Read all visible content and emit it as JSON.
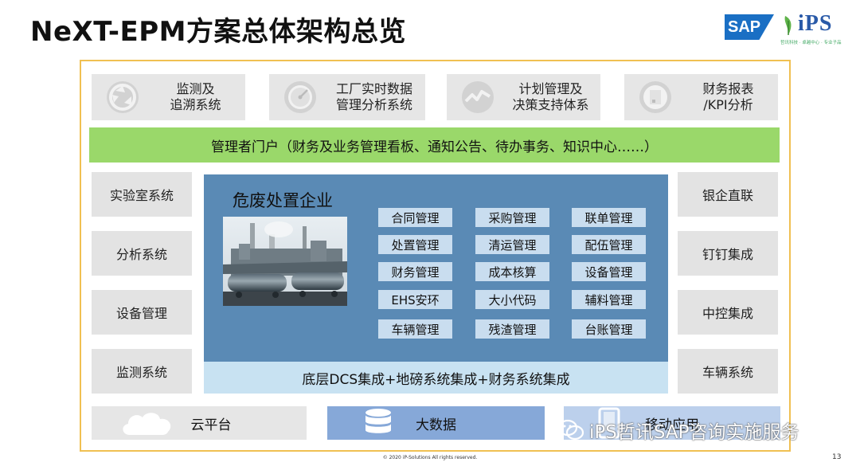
{
  "title": "NeXT-EPM方案总体架构总览",
  "logo": {
    "brand": "SAP",
    "partner": "iPS",
    "tagline": "哲讯科技 · 卓越中心 · 专业子品"
  },
  "top_systems": [
    {
      "label": "监测及\n追溯系统",
      "icon": "recycle-icon"
    },
    {
      "label": "工厂实时数据\n管理分析系统",
      "icon": "gauge-icon"
    },
    {
      "label": "计划管理及\n决策支持体系",
      "icon": "trend-icon"
    },
    {
      "label": "财务报表\n/KPI分析",
      "icon": "document-icon"
    }
  ],
  "portal": "管理者门户（财务及业务管理看板、通知公告、待办事务、知识中心……）",
  "left_systems": [
    "实验室系统",
    "分析系统",
    "设备管理",
    "监测系统"
  ],
  "right_systems": [
    "银企直联",
    "钉钉集成",
    "中控集成",
    "车辆系统"
  ],
  "main": {
    "title": "危废处置企业",
    "modules": [
      [
        "合同管理",
        "采购管理",
        "联单管理"
      ],
      [
        "处置管理",
        "清运管理",
        "配伍管理"
      ],
      [
        "财务管理",
        "成本核算",
        "设备管理"
      ],
      [
        "EHS安环",
        "大小代码",
        "辅料管理"
      ],
      [
        "车辆管理",
        "残渣管理",
        "台账管理"
      ]
    ],
    "integration": "底层DCS集成+地磅系统集成+财务系统集成"
  },
  "bottom": [
    {
      "label": "云平台",
      "icon": "cloud-icon"
    },
    {
      "label": "大数据",
      "icon": "database-icon"
    },
    {
      "label": "移动应用",
      "icon": "mobile-icon"
    }
  ],
  "watermark": "iPS哲讯SAP咨询实施服务",
  "copyright": "© 2020 iP-Solutions All rights reserved.",
  "page_number": "13",
  "colors": {
    "frame": "#f0c052",
    "portal": "#9ad86a",
    "main": "#5a8ab5",
    "module": "#c9ddef",
    "integration": "#c8e2f2",
    "gray_box": "#e6e6e6",
    "cloud_box": "#e6e6e6",
    "bigdata_box": "#86a8d8",
    "mobile_box": "#bcd0ec"
  }
}
